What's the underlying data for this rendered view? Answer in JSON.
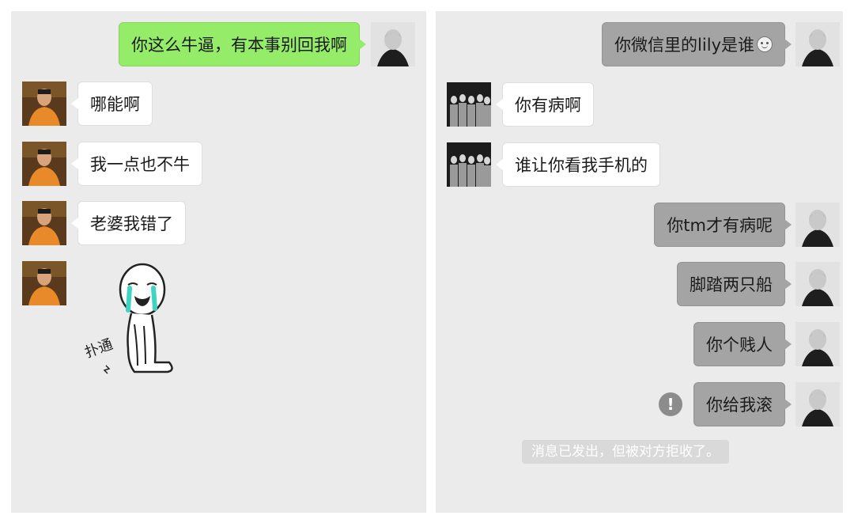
{
  "left_chat": {
    "messages": [
      {
        "side": "right",
        "text": "你这么牛逼，有本事别回我啊"
      },
      {
        "side": "left",
        "text": "哪能啊"
      },
      {
        "side": "left",
        "text": "我一点也不牛"
      },
      {
        "side": "left",
        "text": "老婆我错了"
      }
    ],
    "sticker": {
      "text": "扑通"
    }
  },
  "right_chat": {
    "messages": [
      {
        "side": "right",
        "text": "你微信里的lily是谁"
      },
      {
        "side": "left",
        "text": "你有病啊"
      },
      {
        "side": "left",
        "text": "谁让你看我手机的"
      },
      {
        "side": "right",
        "text": "你tm才有病呢"
      },
      {
        "side": "right",
        "text": "脚踏两只船"
      },
      {
        "side": "right",
        "text": "你个贱人"
      },
      {
        "side": "right",
        "text": "你给我滚"
      }
    ],
    "warning_symbol": "!",
    "system_notice": "消息已发出，但被对方拒收了。"
  },
  "colors": {
    "panel_bg": "#ebebeb",
    "green_bubble": "#95ec69",
    "white_bubble": "#ffffff",
    "gray_bubble": "#a4a4a4"
  }
}
